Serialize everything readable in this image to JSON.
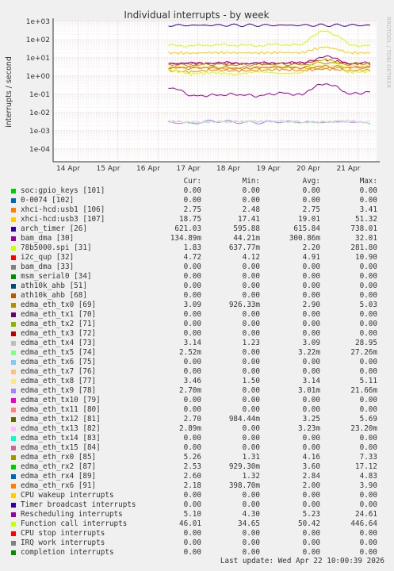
{
  "title": "Individual interrupts - by week",
  "watermark": "RRDTOOL / TOBI OETIKER",
  "footer": "Last update: Wed Apr 22 10:00:39 2026",
  "legend_headers": {
    "cur": "Cur:",
    "min": "Min:",
    "avg": "Avg:",
    "max": "Max:"
  },
  "legend": [
    {
      "name": "soc:gpio_keys [101]",
      "color": "#00cc00",
      "cur": "0.00",
      "min": "0.00",
      "avg": "0.00",
      "max": "0.00"
    },
    {
      "name": "0-0074 [102]",
      "color": "#0066b3",
      "cur": "0.00",
      "min": "0.00",
      "avg": "0.00",
      "max": "0.00"
    },
    {
      "name": "xhci-hcd:usb1 [106]",
      "color": "#ff8000",
      "cur": "2.75",
      "min": "2.48",
      "avg": "2.75",
      "max": "3.41"
    },
    {
      "name": "xhci-hcd:usb3 [107]",
      "color": "#ffcc00",
      "cur": "18.75",
      "min": "17.41",
      "avg": "19.01",
      "max": "51.32"
    },
    {
      "name": "arch_timer [26]",
      "color": "#330099",
      "cur": "621.03",
      "min": "595.88",
      "avg": "615.84",
      "max": "738.01"
    },
    {
      "name": "bam_dma [30]",
      "color": "#990099",
      "cur": "134.89m",
      "min": "44.21m",
      "avg": "300.86m",
      "max": "32.01"
    },
    {
      "name": "78b5000.spi [31]",
      "color": "#ccff00",
      "cur": "1.83",
      "min": "637.77m",
      "avg": "2.20",
      "max": "281.80"
    },
    {
      "name": "i2c_qup [32]",
      "color": "#ff0000",
      "cur": "4.72",
      "min": "4.12",
      "avg": "4.91",
      "max": "10.90"
    },
    {
      "name": "bam_dma [33]",
      "color": "#808080",
      "cur": "0.00",
      "min": "0.00",
      "avg": "0.00",
      "max": "0.00"
    },
    {
      "name": "msm_serial0 [34]",
      "color": "#008f00",
      "cur": "0.00",
      "min": "0.00",
      "avg": "0.00",
      "max": "0.00"
    },
    {
      "name": "ath10k_ahb [51]",
      "color": "#00487d",
      "cur": "0.00",
      "min": "0.00",
      "avg": "0.00",
      "max": "0.00"
    },
    {
      "name": "ath10k_ahb [68]",
      "color": "#b35a00",
      "cur": "0.00",
      "min": "0.00",
      "avg": "0.00",
      "max": "0.00"
    },
    {
      "name": "edma_eth_tx0 [69]",
      "color": "#b38f00",
      "cur": "3.09",
      "min": "926.33m",
      "avg": "2.90",
      "max": "5.03"
    },
    {
      "name": "edma_eth_tx1 [70]",
      "color": "#6b006b",
      "cur": "0.00",
      "min": "0.00",
      "avg": "0.00",
      "max": "0.00"
    },
    {
      "name": "edma_eth_tx2 [71]",
      "color": "#8fb300",
      "cur": "0.00",
      "min": "0.00",
      "avg": "0.00",
      "max": "0.00"
    },
    {
      "name": "edma_eth_tx3 [72]",
      "color": "#b30000",
      "cur": "0.00",
      "min": "0.00",
      "avg": "0.00",
      "max": "0.00"
    },
    {
      "name": "edma_eth_tx4 [73]",
      "color": "#bebebe",
      "cur": "3.14",
      "min": "1.23",
      "avg": "3.09",
      "max": "28.95"
    },
    {
      "name": "edma_eth_tx5 [74]",
      "color": "#80ff80",
      "cur": "2.52m",
      "min": "0.00",
      "avg": "3.22m",
      "max": "27.26m"
    },
    {
      "name": "edma_eth_tx6 [75]",
      "color": "#80c9ff",
      "cur": "0.00",
      "min": "0.00",
      "avg": "0.00",
      "max": "0.00"
    },
    {
      "name": "edma_eth_tx7 [76]",
      "color": "#ffc080",
      "cur": "0.00",
      "min": "0.00",
      "avg": "0.00",
      "max": "0.00"
    },
    {
      "name": "edma_eth_tx8 [77]",
      "color": "#ffe680",
      "cur": "3.46",
      "min": "1.50",
      "avg": "3.14",
      "max": "5.11"
    },
    {
      "name": "edma_eth_tx9 [78]",
      "color": "#aa80ff",
      "cur": "2.70m",
      "min": "0.00",
      "avg": "3.01m",
      "max": "21.66m"
    },
    {
      "name": "edma_eth_tx10 [79]",
      "color": "#ee00cc",
      "cur": "0.00",
      "min": "0.00",
      "avg": "0.00",
      "max": "0.00"
    },
    {
      "name": "edma_eth_tx11 [80]",
      "color": "#ff8080",
      "cur": "0.00",
      "min": "0.00",
      "avg": "0.00",
      "max": "0.00"
    },
    {
      "name": "edma_eth_tx12 [81]",
      "color": "#666600",
      "cur": "2.70",
      "min": "984.44m",
      "avg": "3.25",
      "max": "5.69"
    },
    {
      "name": "edma_eth_tx13 [82]",
      "color": "#ffbfff",
      "cur": "2.89m",
      "min": "0.00",
      "avg": "3.23m",
      "max": "23.20m"
    },
    {
      "name": "edma_eth_tx14 [83]",
      "color": "#00ffcc",
      "cur": "0.00",
      "min": "0.00",
      "avg": "0.00",
      "max": "0.00"
    },
    {
      "name": "edma_eth_tx15 [84]",
      "color": "#cc6699",
      "cur": "0.00",
      "min": "0.00",
      "avg": "0.00",
      "max": "0.00"
    },
    {
      "name": "edma_eth_rx0 [85]",
      "color": "#999900",
      "cur": "5.26",
      "min": "1.31",
      "avg": "4.16",
      "max": "7.33"
    },
    {
      "name": "edma_eth_rx2 [87]",
      "color": "#00cc00",
      "cur": "2.53",
      "min": "929.30m",
      "avg": "3.60",
      "max": "17.12"
    },
    {
      "name": "edma_eth_rx4 [89]",
      "color": "#0066b3",
      "cur": "2.60",
      "min": "1.32",
      "avg": "2.84",
      "max": "4.83"
    },
    {
      "name": "edma_eth_rx6 [91]",
      "color": "#ff8000",
      "cur": "2.18",
      "min": "398.70m",
      "avg": "2.00",
      "max": "3.90"
    },
    {
      "name": "CPU wakeup interrupts",
      "color": "#ffcc00",
      "cur": "0.00",
      "min": "0.00",
      "avg": "0.00",
      "max": "0.00"
    },
    {
      "name": "Timer broadcast interrupts",
      "color": "#330099",
      "cur": "0.00",
      "min": "0.00",
      "avg": "0.00",
      "max": "0.00"
    },
    {
      "name": "Rescheduling interrupts",
      "color": "#990099",
      "cur": "5.10",
      "min": "4.30",
      "avg": "5.23",
      "max": "24.61"
    },
    {
      "name": "Function call interrupts",
      "color": "#ccff00",
      "cur": "46.01",
      "min": "34.65",
      "avg": "50.42",
      "max": "446.64"
    },
    {
      "name": "CPU stop interrupts",
      "color": "#ff0000",
      "cur": "0.00",
      "min": "0.00",
      "avg": "0.00",
      "max": "0.00"
    },
    {
      "name": "IRQ work interrupts",
      "color": "#808080",
      "cur": "0.00",
      "min": "0.00",
      "avg": "0.00",
      "max": "0.00"
    },
    {
      "name": "completion interrupts",
      "color": "#008f00",
      "cur": "0.00",
      "min": "0.00",
      "avg": "0.00",
      "max": "0.00"
    }
  ],
  "chart_data": {
    "type": "line",
    "title": "Individual interrupts - by week",
    "ylabel": "interrupts / second",
    "yscale": "log",
    "ylim": [
      2e-05,
      1000
    ],
    "yticks": [
      "1e+03",
      "1e+02",
      "1e+01",
      "1e+00",
      "1e-01",
      "1e-02",
      "1e-03",
      "1e-04"
    ],
    "xticks": [
      "14 Apr",
      "15 Apr",
      "16 Apr",
      "17 Apr",
      "18 Apr",
      "19 Apr",
      "20 Apr",
      "21 Apr"
    ],
    "x_start": "13 Apr",
    "x_end": "22 Apr",
    "data_start": "17 Apr",
    "grid": true,
    "series": [
      {
        "name": "arch_timer [26]",
        "color": "#330099",
        "values": [
          615,
          610,
          620,
          618,
          612,
          625,
          616,
          614,
          619,
          621
        ]
      },
      {
        "name": "Function call interrupts",
        "color": "#ccff00",
        "values": [
          48,
          45,
          52,
          50,
          47,
          55,
          49,
          300,
          51,
          46
        ]
      },
      {
        "name": "xhci-hcd:usb3 [107]",
        "color": "#ffcc00",
        "values": [
          19,
          18,
          19.5,
          19,
          18.5,
          20,
          19,
          40,
          19,
          18.75
        ]
      },
      {
        "name": "i2c_qup [32]",
        "color": "#ff0000",
        "values": [
          4.9,
          4.8,
          5.0,
          4.9,
          4.7,
          5.1,
          4.9,
          8.0,
          4.8,
          4.72
        ]
      },
      {
        "name": "Rescheduling interrupts",
        "color": "#990099",
        "values": [
          5.2,
          5.0,
          5.4,
          5.2,
          5.1,
          5.5,
          5.2,
          12,
          5.1,
          5.1
        ]
      },
      {
        "name": "edma_eth_rx0 [85]",
        "color": "#999900",
        "values": [
          4.2,
          3.8,
          4.5,
          4.0,
          4.3,
          4.6,
          4.1,
          5.5,
          4.4,
          5.26
        ]
      },
      {
        "name": "edma_eth_tx8 [77]",
        "color": "#ffe680",
        "values": [
          3.1,
          2.9,
          3.3,
          3.0,
          3.2,
          3.4,
          3.1,
          3.8,
          3.2,
          3.46
        ]
      },
      {
        "name": "edma_eth_tx0 [69]",
        "color": "#b38f00",
        "values": [
          2.9,
          2.7,
          3.1,
          2.8,
          3.0,
          3.2,
          2.9,
          3.5,
          3.0,
          3.09
        ]
      },
      {
        "name": "xhci-hcd:usb1 [106]",
        "color": "#ff8000",
        "values": [
          2.75,
          2.7,
          2.8,
          2.75,
          2.7,
          2.8,
          2.75,
          3.0,
          2.75,
          2.75
        ]
      },
      {
        "name": "edma_eth_rx6 [91]",
        "color": "#ff8000",
        "values": [
          2.0,
          1.7,
          2.2,
          1.9,
          2.1,
          2.3,
          2.0,
          2.5,
          2.0,
          2.18
        ]
      },
      {
        "name": "78b5000.spi [31]",
        "color": "#ccff00",
        "values": [
          2.2,
          1.3,
          1.6,
          1.2,
          1.8,
          1.4,
          1.5,
          9.0,
          1.6,
          1.83
        ]
      },
      {
        "name": "bam_dma [30]",
        "color": "#990099",
        "values": [
          0.25,
          0.08,
          0.09,
          0.1,
          0.08,
          0.12,
          0.09,
          0.4,
          0.1,
          0.135
        ]
      },
      {
        "name": "edma_eth_tx9 [78]",
        "color": "#aa80ff",
        "values": [
          0.003,
          0.0025,
          0.0035,
          0.003,
          0.0028,
          0.0032,
          0.003,
          0.0029,
          0.0031,
          0.0027
        ]
      },
      {
        "name": "edma_eth_tx5 [74]",
        "color": "#80ff80",
        "values": [
          0.0032,
          0.0028,
          0.0034,
          0.0031,
          0.003,
          0.0033,
          0.0032,
          0.003,
          0.0033,
          0.0025
        ]
      },
      {
        "name": "edma_eth_tx13 [82]",
        "color": "#ffbfff",
        "values": [
          0.0032,
          0.003,
          0.0033,
          0.0032,
          0.0031,
          0.0034,
          0.0032,
          0.0031,
          0.0033,
          0.0029
        ]
      }
    ]
  }
}
